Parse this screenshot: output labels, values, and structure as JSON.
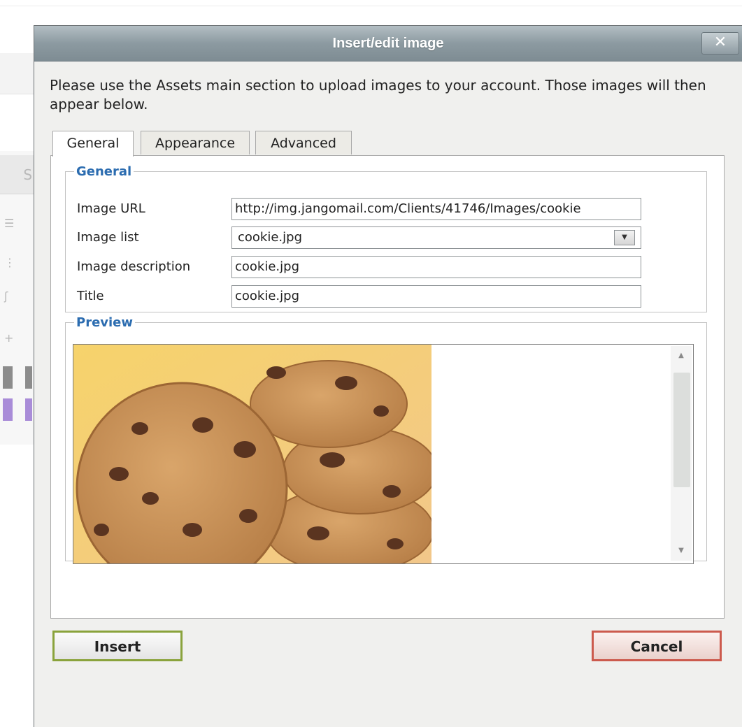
{
  "dialog": {
    "title": "Insert/edit image",
    "close_label": "✕",
    "intro_text": "Please use the Assets main section to upload images to your account. Those images will then appear below."
  },
  "tabs": [
    {
      "label": "General",
      "active": true
    },
    {
      "label": "Appearance",
      "active": false
    },
    {
      "label": "Advanced",
      "active": false
    }
  ],
  "general_section": {
    "legend": "General",
    "fields": {
      "image_url": {
        "label": "Image URL",
        "value": "http://img.jangomail.com/Clients/41746/Images/cookie"
      },
      "image_list": {
        "label": "Image list",
        "value": "cookie.jpg"
      },
      "image_description": {
        "label": "Image description",
        "value": "cookie.jpg"
      },
      "title": {
        "label": "Title",
        "value": "cookie.jpg"
      }
    }
  },
  "preview_section": {
    "legend": "Preview",
    "image_subject": "chocolate chip cookies"
  },
  "buttons": {
    "insert": "Insert",
    "cancel": "Cancel"
  },
  "background": {
    "tab_fragment": "SI"
  },
  "colors": {
    "legend_blue": "#2b6cb0",
    "insert_border": "#8aa33c",
    "cancel_border": "#cc5a4d",
    "titlebar": "#8c9aa1"
  }
}
